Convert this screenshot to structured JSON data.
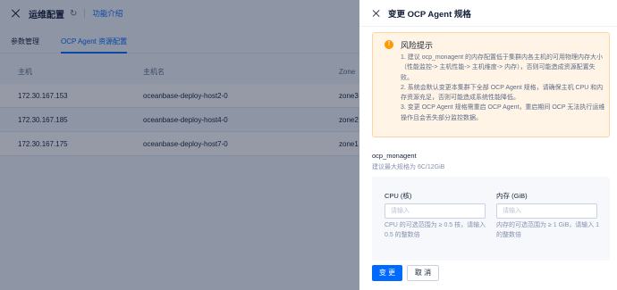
{
  "page": {
    "title": "运维配置",
    "help_link": "功能介绍",
    "tabs": [
      {
        "label": "参数管理",
        "active": false
      },
      {
        "label": "OCP Agent 资源配置",
        "active": true
      }
    ],
    "table": {
      "headers": [
        "主机",
        "主机名",
        "Zone"
      ],
      "rows": [
        [
          "172.30.167.153",
          "oceanbase-deploy-host2-0",
          "zone3"
        ],
        [
          "172.30.167.185",
          "oceanbase-deploy-host4-0",
          "zone2"
        ],
        [
          "172.30.167.175",
          "oceanbase-deploy-host7-0",
          "zone1"
        ]
      ]
    }
  },
  "drawer": {
    "title": "变更 OCP Agent 规格",
    "alert": {
      "title": "风险提示",
      "lines": [
        "1. 建议 ocp_monagent 的内存配置低于集群内各主机的可用物理内存大小（性能监控-> 主机性能-> 主机维度-> 内存），否则可能造成资源配置失败。",
        "2. 系统会默认变更本集群下全部 OCP Agent 规格，请确保主机 CPU 和内存资源充足，否则可能造成系统性能降低。",
        "3. 变更 OCP Agent 规格需重启 OCP Agent，重启期间 OCP 无法执行运维操作且会丢失部分监控数据。"
      ]
    },
    "section_title": "ocp_monagent",
    "section_hint": "建议最大规格为 6C/12GiB",
    "cpu": {
      "label": "CPU (核)",
      "placeholder": "请输入",
      "help": "CPU 的可选范围为 ≥ 0.5 核，请输入 0.5 的整数倍"
    },
    "memory": {
      "label": "内存 (GiB)",
      "placeholder": "请输入",
      "help": "内存的可选范围为 ≥ 1 GiB，请输入 1 的整数倍"
    },
    "buttons": {
      "confirm": "变 更",
      "cancel": "取 消"
    }
  },
  "colors": {
    "primary": "#006aff",
    "warning": "#ff9900",
    "warning_bg": "#fff4e5"
  }
}
